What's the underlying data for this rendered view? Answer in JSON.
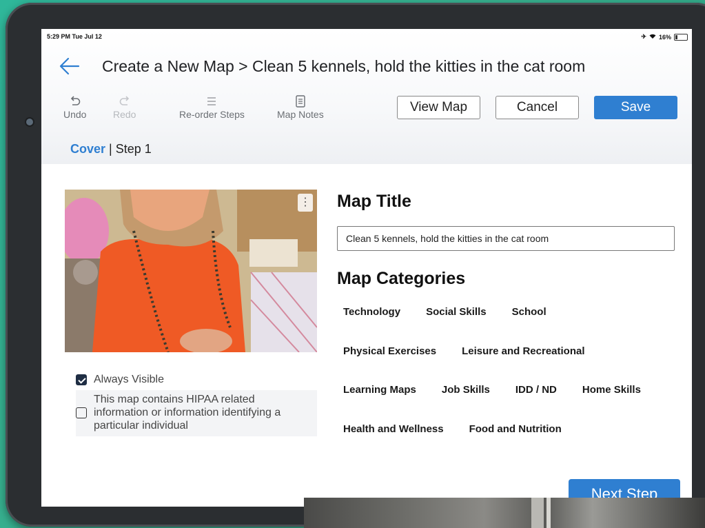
{
  "status": {
    "time": "5:29 PM  Tue Jul 12",
    "battery": "16%"
  },
  "header": {
    "title": "Create a New Map > Clean 5 kennels, hold the kitties in the cat room"
  },
  "toolbar": {
    "undo": "Undo",
    "redo": "Redo",
    "reorder": "Re-order Steps",
    "notes": "Map Notes",
    "view_map": "View Map",
    "cancel": "Cancel",
    "save": "Save"
  },
  "breadcrumb": {
    "cover": "Cover",
    "sep": " | ",
    "step": "Step 1"
  },
  "options": {
    "always_visible": "Always Visible",
    "hipaa": "This map contains HIPAA related information or information identifying a particular individual"
  },
  "form": {
    "title_label": "Map Title",
    "title_value": "Clean 5 kennels, hold the kitties in the cat room",
    "categories_label": "Map Categories",
    "categories": [
      [
        "Technology",
        "Social Skills",
        "School"
      ],
      [
        "Physical Exercises",
        "Leisure and Recreational"
      ],
      [
        "Learning Maps",
        "Job Skills",
        "IDD / ND",
        "Home Skills"
      ],
      [
        "Health and Wellness",
        "Food and Nutrition"
      ]
    ]
  },
  "next_step": "Next Step",
  "colors": {
    "accent": "#2f7fd1",
    "bezel": "#2b2e31",
    "background": "#2fb79a"
  }
}
